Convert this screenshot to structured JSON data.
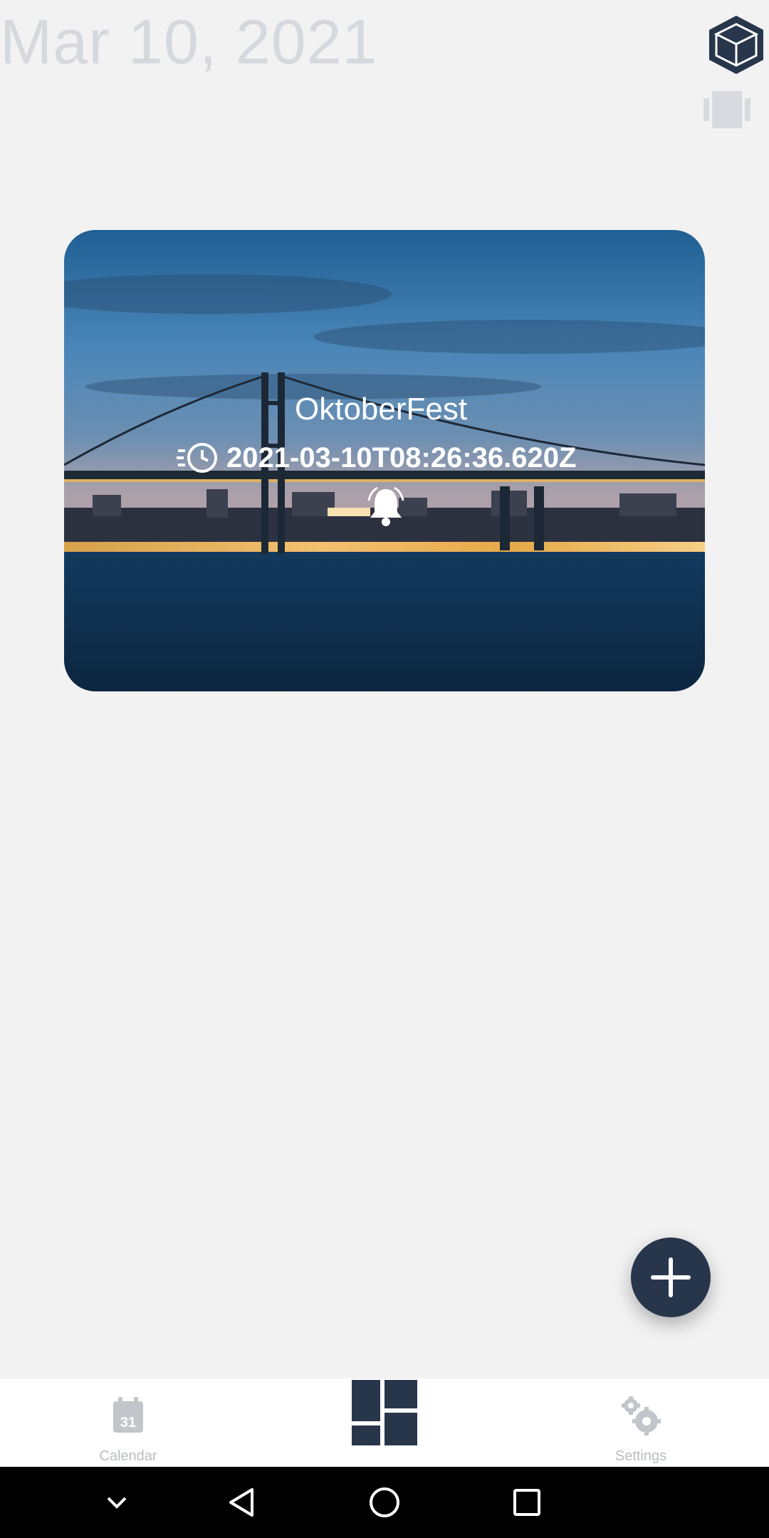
{
  "header": {
    "date": "Mar 10, 2021",
    "cube_icon": "cube-icon",
    "carousel_icon": "carousel-view-icon"
  },
  "event_card": {
    "title": "OktoberFest",
    "datetime": "2021-03-10T08:26:36.620Z",
    "time_icon": "recent-clock-icon",
    "alarm_icon": "bell-icon",
    "background": "night-bridge-photo"
  },
  "fab": {
    "icon": "plus-icon"
  },
  "bottom_nav": {
    "calendar_label": "Calendar",
    "calendar_day": "31",
    "dashboard_icon": "dashboard-icon",
    "settings_label": "Settings"
  },
  "system_nav": {
    "icons": [
      "chevron-down-icon",
      "back-icon",
      "home-icon",
      "recents-icon"
    ]
  },
  "colors": {
    "background": "#f2f2f3",
    "accent": "#27364b",
    "muted_text": "#d5d8dd",
    "nav_label": "#b9bcc2"
  }
}
